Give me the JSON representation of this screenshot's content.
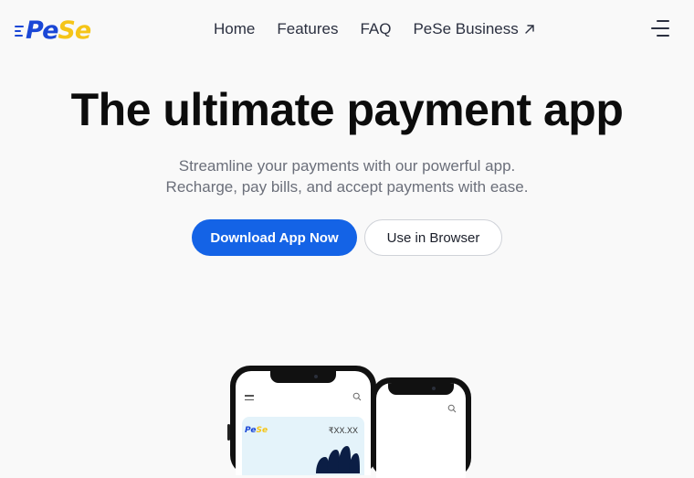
{
  "brand": {
    "part1": "Pe",
    "part2": "Se",
    "primary_color": "#1a47d6",
    "accent_color": "#f5c518"
  },
  "nav": {
    "items": [
      {
        "label": "Home"
      },
      {
        "label": "Features"
      },
      {
        "label": "FAQ"
      },
      {
        "label": "PeSe Business",
        "icon": "external-arrow-icon"
      }
    ],
    "menu_icon": "hamburger-menu-icon"
  },
  "hero": {
    "title": "The ultimate payment app",
    "subtitle_line1": "Streamline your payments with our powerful app.",
    "subtitle_line2": "Recharge, pay bills, and accept payments with ease.",
    "primary_button": "Download App Now",
    "secondary_button": "Use in Browser",
    "primary_color": "#1463e6"
  },
  "phone_preview": {
    "logo_part1": "Pe",
    "logo_part2": "Se",
    "balance": "₹XX.XX"
  }
}
